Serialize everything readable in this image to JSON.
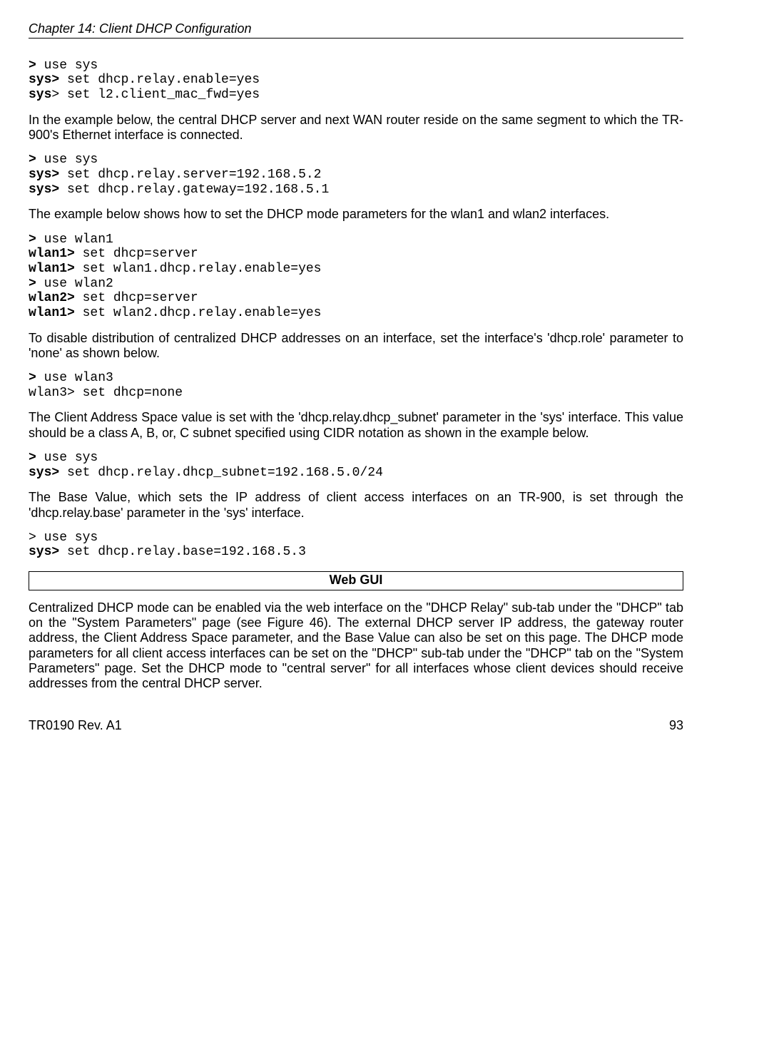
{
  "header": {
    "chapter": "Chapter 14: Client DHCP Configuration"
  },
  "code1": {
    "l1a": ">",
    "l1b": " use sys",
    "l2a": "sys>",
    "l2b": " set dhcp.relay.enable=yes",
    "l3a": "sys",
    "l3b": "> set l2.client_mac_fwd=yes"
  },
  "para1": "In the example below, the central DHCP server and next WAN router reside on the same segment to which the TR-900's Ethernet interface is connected.",
  "code2": {
    "l1a": ">",
    "l1b": " use sys",
    "l2a": "sys>",
    "l2b": " set dhcp.relay.server=192.168.5.2",
    "l3a": "sys>",
    "l3b": " set dhcp.relay.gateway=192.168.5.1"
  },
  "para2": "The example below shows how to set the DHCP mode parameters for the wlan1 and wlan2 interfaces.",
  "code3": {
    "l1a": ">",
    "l1b": " use wlan1",
    "l2a": "wlan1>",
    "l2b": " set dhcp=server",
    "l3a": "wlan1>",
    "l3b": " set wlan1.dhcp.relay.enable=yes",
    "l4a": ">",
    "l4b": " use wlan2",
    "l5a": "wlan2>",
    "l5b": " set dhcp=server",
    "l6a": "wlan1>",
    "l6b": " set wlan2.dhcp.relay.enable=yes"
  },
  "para3": "To disable distribution of centralized DHCP addresses on an interface, set the interface's 'dhcp.role' parameter to 'none' as shown below.",
  "code4": {
    "l1a": ">",
    "l1b": " use wlan3",
    "l2": "wlan3> set dhcp=none"
  },
  "para4": "The Client Address Space value is set with the 'dhcp.relay.dhcp_subnet' parameter in the 'sys' interface. This value should be a class A, B, or, C subnet specified using CIDR notation as shown in the example below.",
  "code5": {
    "l1a": ">",
    "l1b": " use sys",
    "l2a": "sys>",
    "l2b": " set dhcp.relay.dhcp_subnet=192.168.5.0/24"
  },
  "para5": "The Base Value, which sets the IP address of client access interfaces on an TR-900, is set through the 'dhcp.relay.base' parameter in the 'sys' interface.",
  "code6": {
    "l1": "> use sys",
    "l2a": "sys>",
    "l2b": " set dhcp.relay.base=192.168.5.3"
  },
  "webgui": {
    "title": "Web GUI"
  },
  "para6": "Centralized DHCP mode can be enabled via the web interface on the \"DHCP Relay\" sub-tab under the \"DHCP\" tab on the \"System Parameters\" page (see Figure 46). The external DHCP server IP address, the gateway router address, the Client Address Space parameter, and the Base Value can also be set on this page. The DHCP mode parameters for all client access interfaces can be set on the \"DHCP\" sub-tab under the \"DHCP\" tab on the \"System Parameters\" page. Set the DHCP mode to \"central server\" for all interfaces whose client devices should receive addresses from the central DHCP server.",
  "footer": {
    "left": "TR0190 Rev. A1",
    "right": "93"
  }
}
